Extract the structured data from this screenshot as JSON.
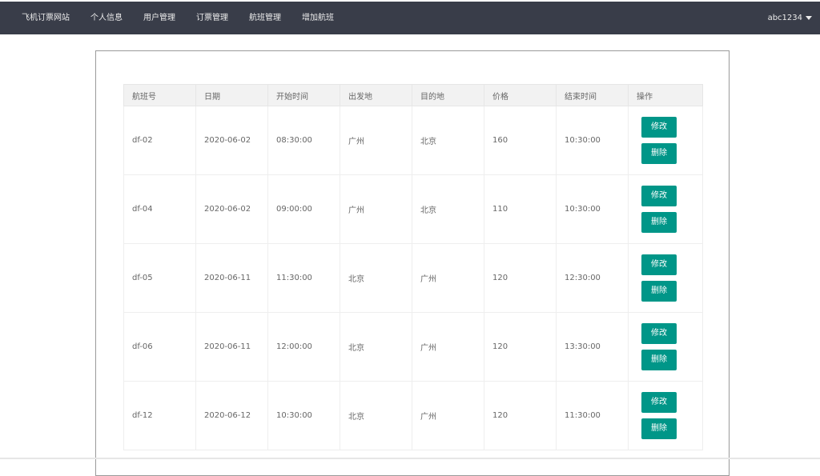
{
  "nav": {
    "items": [
      {
        "label": "飞机订票网站"
      },
      {
        "label": "个人信息"
      },
      {
        "label": "用户管理"
      },
      {
        "label": "订票管理"
      },
      {
        "label": "航班管理"
      },
      {
        "label": "增加航班"
      }
    ],
    "user": "abc1234"
  },
  "table": {
    "headers": [
      "航班号",
      "日期",
      "开始时间",
      "出发地",
      "目的地",
      "价格",
      "结束时间",
      "操作"
    ],
    "rows": [
      {
        "flight": "df-02",
        "date": "2020-06-02",
        "start": "08:30:00",
        "from": "广州",
        "to": "北京",
        "price": "160",
        "end": "10:30:00"
      },
      {
        "flight": "df-04",
        "date": "2020-06-02",
        "start": "09:00:00",
        "from": "广州",
        "to": "北京",
        "price": "110",
        "end": "10:30:00"
      },
      {
        "flight": "df-05",
        "date": "2020-06-11",
        "start": "11:30:00",
        "from": "北京",
        "to": "广州",
        "price": "120",
        "end": "12:30:00"
      },
      {
        "flight": "df-06",
        "date": "2020-06-11",
        "start": "12:00:00",
        "from": "北京",
        "to": "广州",
        "price": "120",
        "end": "13:30:00"
      },
      {
        "flight": "df-12",
        "date": "2020-06-12",
        "start": "10:30:00",
        "from": "北京",
        "to": "广州",
        "price": "120",
        "end": "11:30:00"
      }
    ],
    "edit_label": "修改",
    "delete_label": "删除"
  },
  "colors": {
    "topbar": "#393d49",
    "button": "#009688"
  }
}
